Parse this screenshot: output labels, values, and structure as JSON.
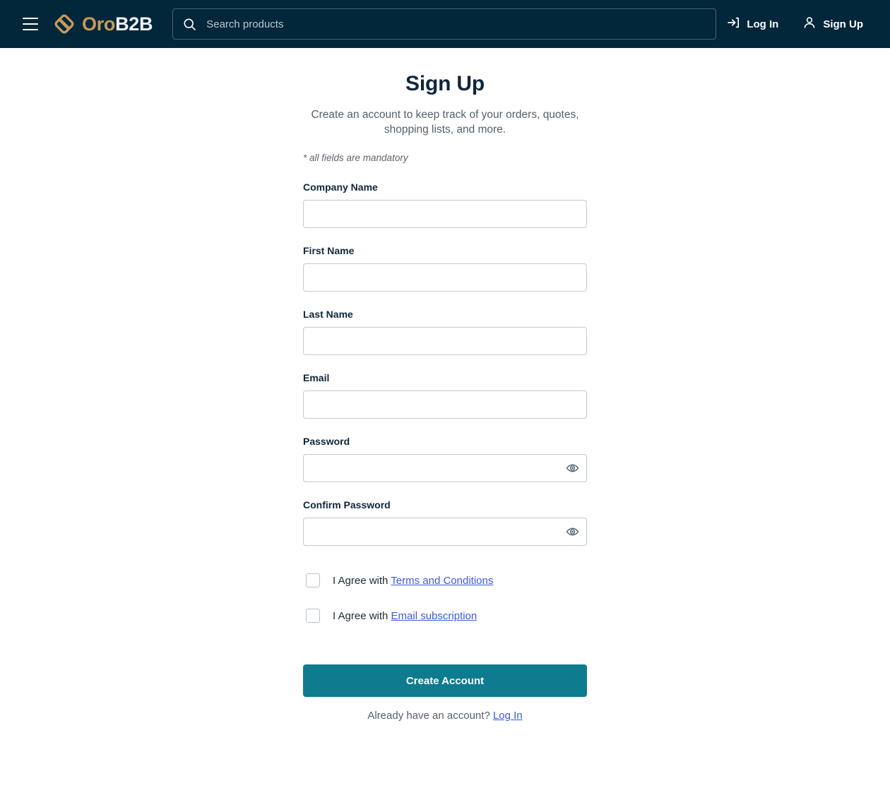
{
  "header": {
    "menu_icon": "hamburger-menu-icon",
    "brand": {
      "logo_icon": "oro-diamond-logo-icon",
      "name_primary": "Oro",
      "name_secondary": "B2B"
    },
    "search": {
      "icon": "search-icon",
      "placeholder": "Search products",
      "value": ""
    },
    "actions": [
      {
        "label": "Log In",
        "icon": "login-arrow-icon"
      },
      {
        "label": "Sign Up",
        "icon": "user-person-icon"
      }
    ]
  },
  "main": {
    "title": "Sign Up",
    "subtitle": "Create an account to keep track of your orders, quotes, shopping lists, and more.",
    "mandatory_note": "* all fields are mandatory",
    "fields": [
      {
        "label": "Company Name",
        "value": "",
        "placeholder": "",
        "type": "text",
        "has_eye": false
      },
      {
        "label": "First Name",
        "value": "",
        "placeholder": "",
        "type": "text",
        "has_eye": false
      },
      {
        "label": "Last Name",
        "value": "",
        "placeholder": "",
        "type": "text",
        "has_eye": false
      },
      {
        "label": "Email",
        "value": "",
        "placeholder": "",
        "type": "text",
        "has_eye": false
      },
      {
        "label": "Password",
        "value": "",
        "placeholder": "",
        "type": "password",
        "has_eye": true
      },
      {
        "label": "Confirm Password",
        "value": "",
        "placeholder": "",
        "type": "password",
        "has_eye": true
      }
    ],
    "agreements": [
      {
        "prefix": "I Agree with ",
        "link": "Terms and Conditions",
        "checked": false
      },
      {
        "prefix": "I Agree with ",
        "link": "Email subscription",
        "checked": false
      }
    ],
    "submit_label": "Create Account",
    "footer": {
      "text": "Already have an account? ",
      "link": "Log In"
    }
  },
  "colors": {
    "header_bg": "#02263A",
    "brand_gold": "#C69A5B",
    "accent_teal": "#0F7B8F",
    "link_blue": "#3B5BDB",
    "title_navy": "#10263B",
    "border_gray": "#C3CBD1"
  }
}
